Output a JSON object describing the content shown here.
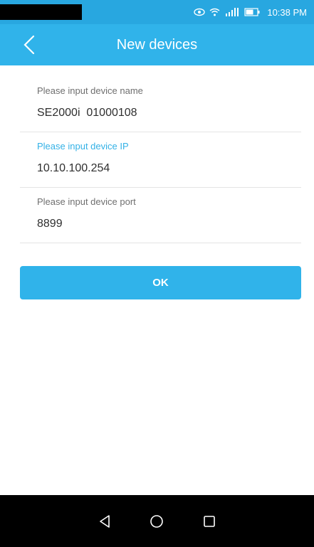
{
  "status_bar": {
    "time": "10:38 PM",
    "icons": [
      "eye-icon",
      "wifi-icon",
      "cellular-signal-icon",
      "battery-icon"
    ],
    "color": "#28a7e0"
  },
  "app_bar": {
    "title": "New devices",
    "back_icon": "chevron-left-icon",
    "color": "#30b3ea"
  },
  "form": {
    "fields": [
      {
        "label": "Please input device name",
        "value": "SE2000i  01000108",
        "focused": false
      },
      {
        "label": "Please input device IP",
        "value": "10.10.100.254",
        "focused": true
      },
      {
        "label": "Please input device port",
        "value": "8899",
        "focused": false
      }
    ]
  },
  "actions": {
    "ok_label": "OK"
  },
  "nav_bar": {
    "buttons": [
      "back-triangle-icon",
      "home-circle-icon",
      "recents-square-icon"
    ]
  },
  "colors": {
    "accent": "#30b3ea",
    "focused_label": "#33b1e6"
  }
}
